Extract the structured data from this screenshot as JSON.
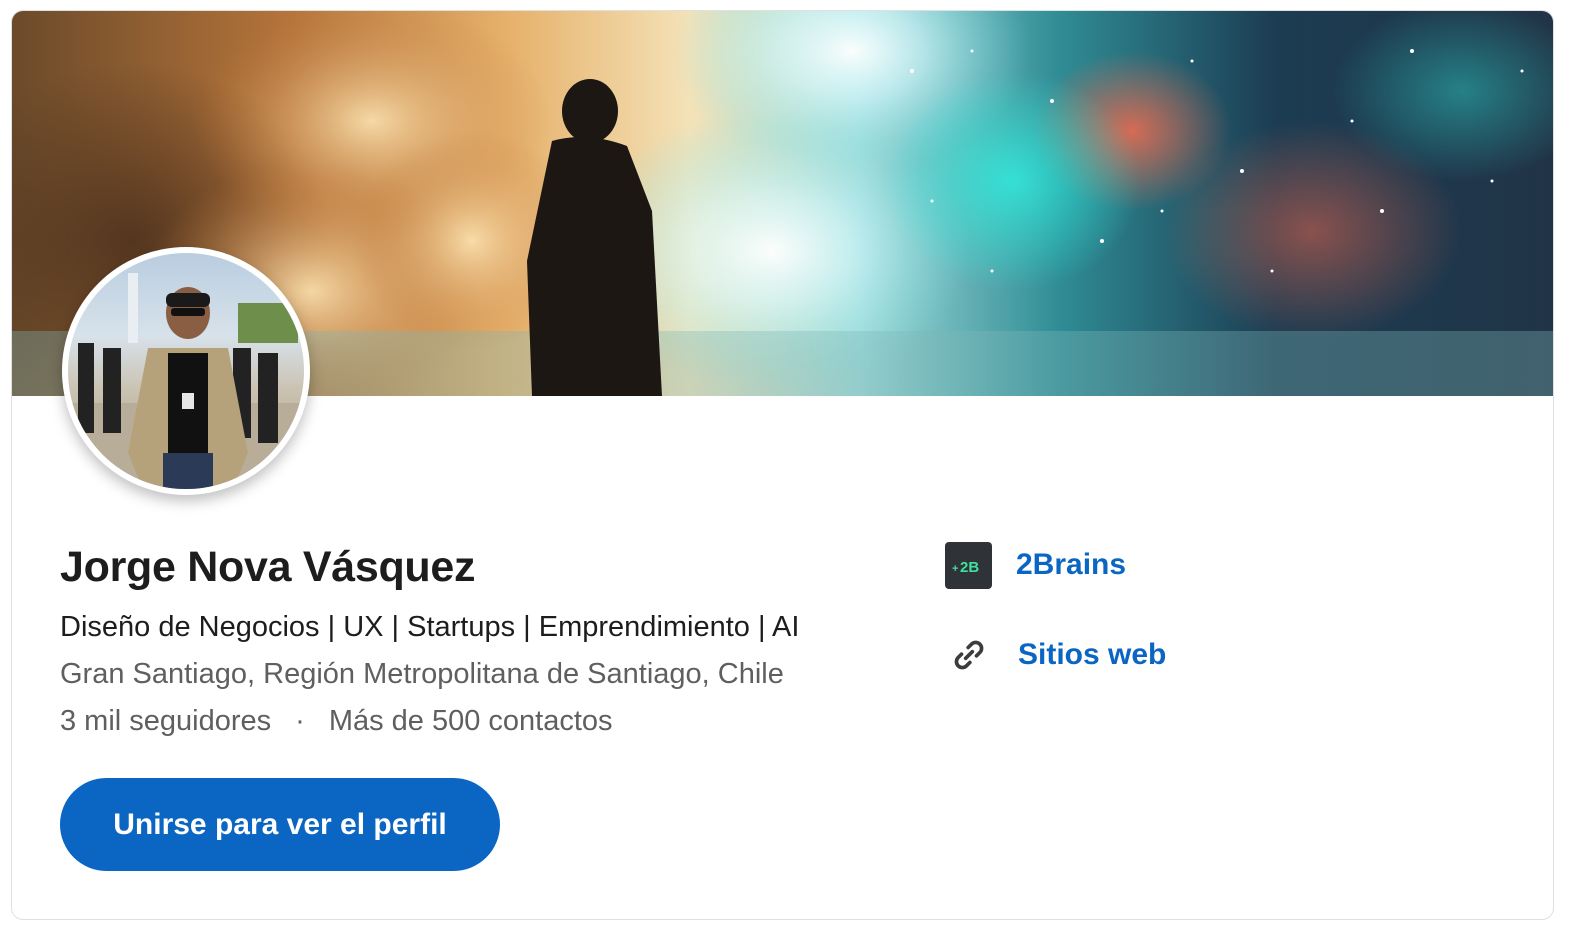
{
  "profile": {
    "name": "Jorge Nova Vásquez",
    "headline": "Diseño de Negocios | UX | Startups | Emprendimiento | AI",
    "location": "Gran Santiago, Región Metropolitana de Santiago, Chile",
    "followers": "3 mil seguidores",
    "separator": "·",
    "connections": "Más de 500 contactos",
    "join_button_label": "Unirse para ver el perfil"
  },
  "sidebar": {
    "company": {
      "name": "2Brains",
      "logo_text": "2B",
      "logo_icon": "2brains-logo",
      "logo_color": "#2f3236",
      "logo_accent": "#3fe0a0"
    },
    "websites_label": "Sitios web",
    "websites_icon": "link-icon"
  },
  "colors": {
    "accent": "#0a66c2",
    "primary_text": "#1d1d1d",
    "secondary_text": "#5f5f5f"
  }
}
